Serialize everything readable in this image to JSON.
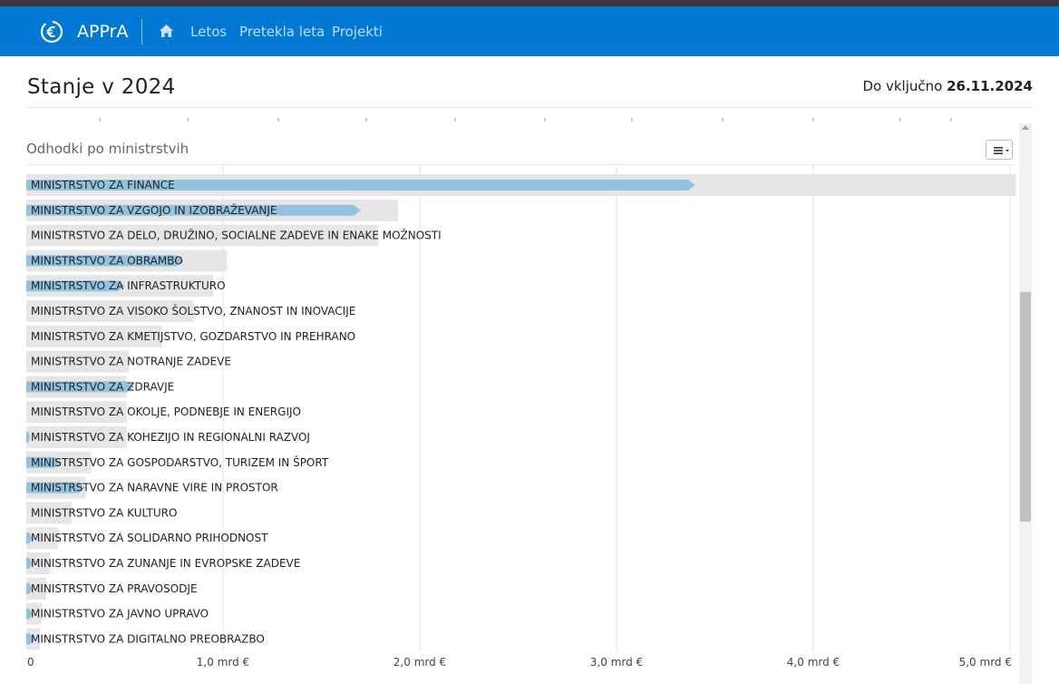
{
  "navbar": {
    "brand": "APPrA",
    "links": [
      "Letos",
      "Pretekla leta",
      "Projekti"
    ]
  },
  "header": {
    "title": "Stanje v 2024",
    "date_prefix": "Do vključno",
    "date_value": "26.11.2024"
  },
  "panel": {
    "title": "Odhodki po ministrstvih"
  },
  "colors": {
    "navbar": "#0078d4",
    "bar_spent": "#93c2e1",
    "bar_budget": "#e6e6e6"
  },
  "icons": [
    "euro-logo-icon",
    "home-icon",
    "hamburger-menu-icon"
  ],
  "chart_data": {
    "type": "bar",
    "orientation": "horizontal",
    "title": "Odhodki po ministrstvih",
    "xlim": [
      0,
      5
    ],
    "x_unit": "mrd €",
    "x_tick_values": [
      0,
      1,
      2,
      3,
      4,
      5
    ],
    "x_tick_labels": [
      "0",
      "1,0 mrd €",
      "2,0 mrd €",
      "3,0 mrd €",
      "4,0 mrd €",
      "5,0 mrd €"
    ],
    "grid": true,
    "categories": [
      "MINISTRSTVO ZA FINANCE",
      "MINISTRSTVO ZA VZGOJO IN IZOBRAŽEVANJE",
      "MINISTRSTVO ZA DELO, DRUŽINO, SOCIALNE ZADEVE IN ENAKE MOŽNOSTI",
      "MINISTRSTVO ZA OBRAMBO",
      "MINISTRSTVO ZA INFRASTRUKTURO",
      "MINISTRSTVO ZA VISOKO ŠOLSTVO, ZNANOST IN INOVACIJE",
      "MINISTRSTVO ZA KMETIJSTVO, GOZDARSTVO IN PREHRANO",
      "MINISTRSTVO ZA NOTRANJE ZADEVE",
      "MINISTRSTVO ZA ZDRAVJE",
      "MINISTRSTVO ZA OKOLJE, PODNEBJE IN ENERGIJO",
      "MINISTRSTVO ZA KOHEZIJO IN REGIONALNI RAZVOJ",
      "MINISTRSTVO ZA GOSPODARSTVO, TURIZEM IN ŠPORT",
      "MINISTRSTVO ZA NARAVNE VIRE IN PROSTOR",
      "MINISTRSTVO ZA KULTURO",
      "MINISTRSTVO ZA SOLIDARNO PRIHODNOST",
      "MINISTRSTVO ZA ZUNANJE IN EVROPSKE ZADEVE",
      "MINISTRSTVO ZA PRAVOSODJE",
      "MINISTRSTVO ZA JAVNO UPRAVO",
      "MINISTRSTVO ZA DIGITALNO PREOBRAZBO"
    ],
    "series": [
      {
        "values": [
          5.03,
          1.89,
          1.79,
          1.02,
          0.95,
          0.85,
          0.69,
          0.52,
          0.51,
          0.51,
          0.51,
          0.33,
          0.3,
          0.23,
          0.16,
          0.12,
          0.1,
          0.08,
          0.07
        ]
      },
      {
        "values": [
          3.4,
          1.7,
          0.0,
          0.8,
          0.5,
          0.0,
          0.0,
          0.0,
          0.55,
          0.0,
          0.02,
          0.18,
          0.3,
          0.0,
          0.03,
          0.03,
          0.03,
          0.03,
          0.04
        ]
      }
    ]
  }
}
